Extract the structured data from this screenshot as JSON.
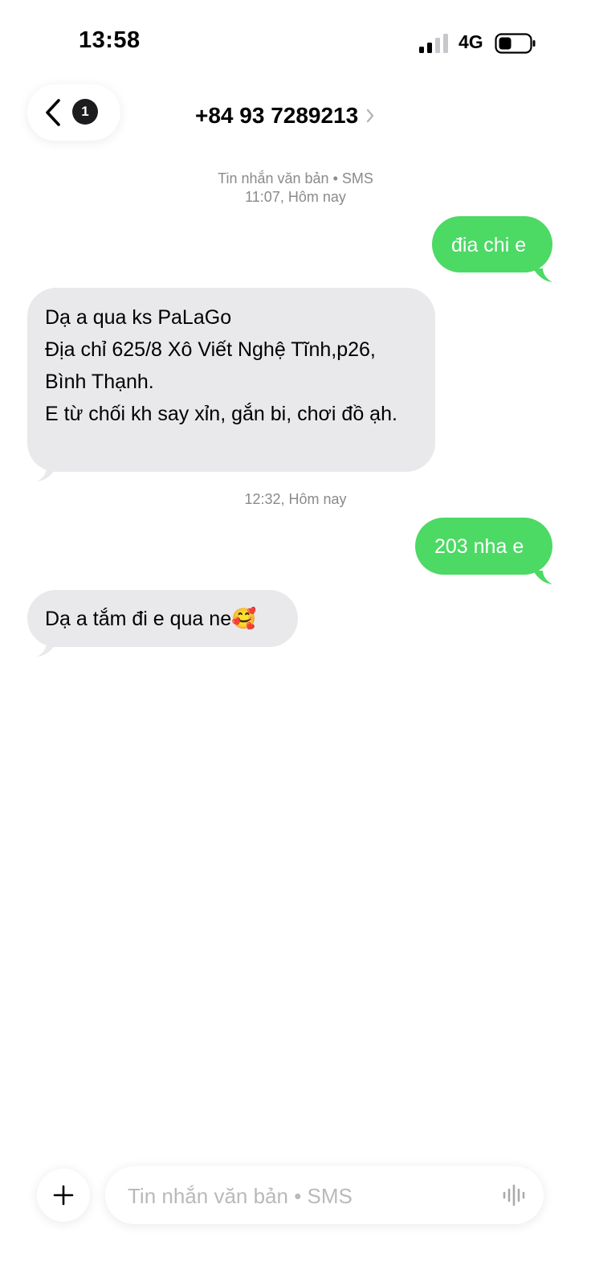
{
  "status_bar": {
    "time": "13:58",
    "network": "4G"
  },
  "header": {
    "unread_count": "1",
    "contact": "+84 93 7289213"
  },
  "thread": {
    "meta_1_line1": "Tin nhắn văn bản • SMS",
    "meta_1_line2": "11:07, Hôm nay",
    "msg_1": "đia chi e",
    "msg_2": " Dạ a qua ks PaLaGo\nĐịa chỉ 625/8 Xô Viết Nghệ Tĩnh,p26, Bình Thạnh.\nE từ chối kh say xỉn, gắn bi, chơi đồ ạh.",
    "meta_2": "12:32, Hôm nay",
    "msg_3": "203 nha e",
    "msg_4": "Dạ a tắm đi e qua ne🥰"
  },
  "composer": {
    "placeholder": "Tin nhắn văn bản • SMS"
  },
  "colors": {
    "outgoing": "#4cd964",
    "incoming": "#e9e9eb",
    "meta": "#8a8a8e"
  }
}
